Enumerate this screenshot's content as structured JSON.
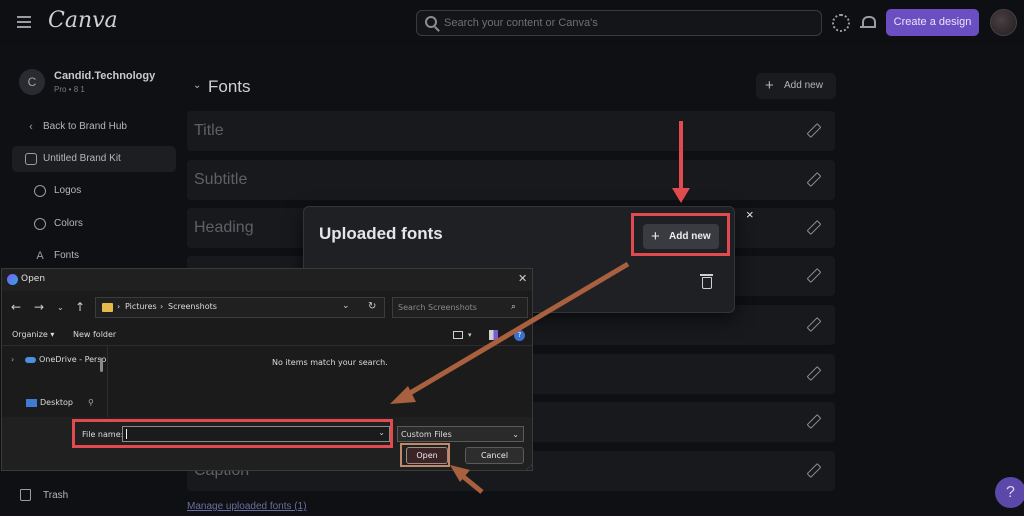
{
  "topbar": {
    "logo": "Canva",
    "search_placeholder": "Search your content or Canva's",
    "create_label": "Create a design"
  },
  "account": {
    "initial": "C",
    "name": "Candid.Technology",
    "plan": "Pro • 8 1"
  },
  "sidebar": {
    "back": "Back to Brand Hub",
    "kit": "Untitled Brand Kit",
    "items": [
      "Logos",
      "Colors",
      "Fonts"
    ],
    "trash": "Trash"
  },
  "fonts": {
    "heading": "Fonts",
    "add_new": "Add new",
    "rows": [
      "Title",
      "Subtitle",
      "Heading",
      "",
      "",
      "",
      "",
      "",
      "Caption"
    ],
    "manage_link": "Manage uploaded fonts (1)"
  },
  "modal": {
    "title": "Uploaded fonts",
    "add_new": "Add new",
    "close": "×"
  },
  "dialog": {
    "title": "Open",
    "close": "✕",
    "path": [
      "Pictures",
      "Screenshots"
    ],
    "search_placeholder": "Search Screenshots",
    "organize": "Organize ▾",
    "new_folder": "New folder",
    "tree": [
      "OneDrive - Perso",
      "Desktop"
    ],
    "empty_message": "No items match your search.",
    "file_name_label": "File name:",
    "file_name_value": "",
    "file_type": "Custom Files",
    "open_label": "Open",
    "cancel_label": "Cancel"
  },
  "help": "?",
  "colors": {
    "accent": "#6b4fc2",
    "highlight_red": "#e14a4f",
    "highlight_brown": "#c08a6a",
    "arrow_brown": "#a8603f"
  },
  "icons": [
    "hamburger-icon",
    "search-icon",
    "gear-icon",
    "bell-icon",
    "chevron-left-icon",
    "brand-kit-icon",
    "logos-icon",
    "colors-icon",
    "fonts-icon",
    "trash-icon",
    "pencil-icon",
    "plus-icon",
    "close-icon",
    "folder-icon",
    "refresh-icon",
    "onedrive-icon",
    "desktop-icon",
    "pin-icon",
    "help-icon"
  ]
}
